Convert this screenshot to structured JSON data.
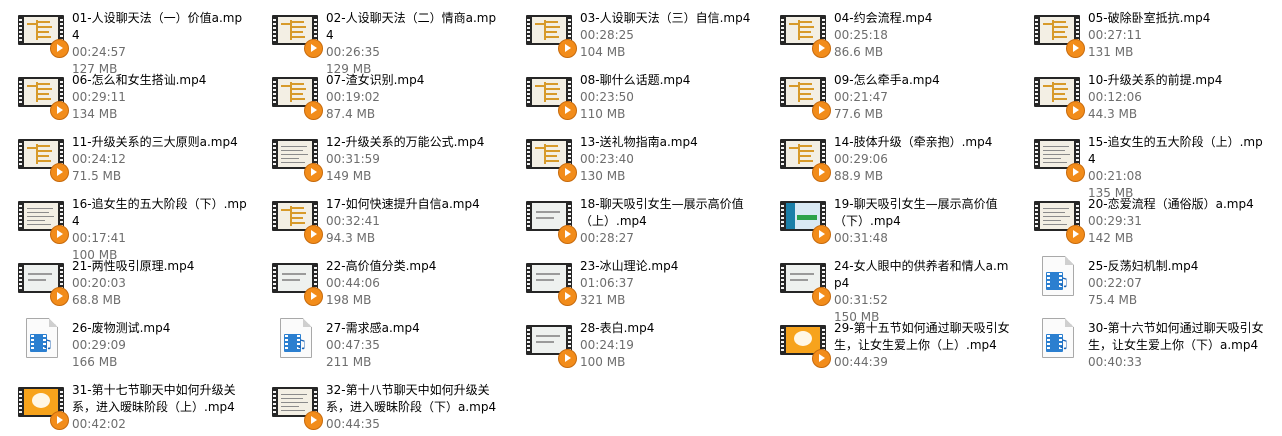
{
  "colors": {
    "duration_text": "#6d6d6d",
    "play_badge": "#f28c1a",
    "media_icon": "#2b7fd0"
  },
  "files": [
    {
      "name": "01-人设聊天法（一）价值a.mp4",
      "duration": "00:24:57",
      "size": "127 MB",
      "icon": "video-thumbnail-icon"
    },
    {
      "name": "02-人设聊天法（二）情商a.mp4",
      "duration": "00:26:35",
      "size": "129 MB",
      "icon": "video-thumbnail-icon"
    },
    {
      "name": "03-人设聊天法（三）自信.mp4",
      "duration": "00:28:25",
      "size": "104 MB",
      "icon": "video-thumbnail-icon"
    },
    {
      "name": "04-约会流程.mp4",
      "duration": "00:25:18",
      "size": "86.6 MB",
      "icon": "video-thumbnail-icon"
    },
    {
      "name": "05-破除卧室抵抗.mp4",
      "duration": "00:27:11",
      "size": "131 MB",
      "icon": "video-thumbnail-icon"
    },
    {
      "name": "06-怎么和女生搭讪.mp4",
      "duration": "00:29:11",
      "size": "134 MB",
      "icon": "video-thumbnail-icon"
    },
    {
      "name": "07-渣女识别.mp4",
      "duration": "00:19:02",
      "size": "87.4 MB",
      "icon": "video-thumbnail-icon"
    },
    {
      "name": "08-聊什么话题.mp4",
      "duration": "00:23:50",
      "size": "110 MB",
      "icon": "video-thumbnail-icon"
    },
    {
      "name": "09-怎么牵手a.mp4",
      "duration": "00:21:47",
      "size": "77.6 MB",
      "icon": "video-thumbnail-icon"
    },
    {
      "name": "10-升级关系的前提.mp4",
      "duration": "00:12:06",
      "size": "44.3 MB",
      "icon": "video-thumbnail-icon"
    },
    {
      "name": "11-升级关系的三大原则a.mp4",
      "duration": "00:24:12",
      "size": "71.5 MB",
      "icon": "video-thumbnail-icon"
    },
    {
      "name": "12-升级关系的万能公式.mp4",
      "duration": "00:31:59",
      "size": "149 MB",
      "icon": "video-thumbnail-icon"
    },
    {
      "name": "13-送礼物指南a.mp4",
      "duration": "00:23:40",
      "size": "130 MB",
      "icon": "video-thumbnail-icon"
    },
    {
      "name": "14-肢体升级（牵亲抱）.mp4",
      "duration": "00:29:06",
      "size": "88.9 MB",
      "icon": "video-thumbnail-icon"
    },
    {
      "name": "15-追女生的五大阶段（上）.mp4",
      "duration": "00:21:08",
      "size": "135 MB",
      "icon": "video-thumbnail-icon"
    },
    {
      "name": "16-追女生的五大阶段（下）.mp4",
      "duration": "00:17:41",
      "size": "100 MB",
      "icon": "video-thumbnail-icon"
    },
    {
      "name": "17-如何快速提升自信a.mp4",
      "duration": "00:32:41",
      "size": "94.3 MB",
      "icon": "video-thumbnail-icon"
    },
    {
      "name": "18-聊天吸引女生—展示高价值（上）.mp4",
      "duration": "00:28:27",
      "size": "",
      "icon": "video-thumbnail-icon"
    },
    {
      "name": "19-聊天吸引女生—展示高价值（下）.mp4",
      "duration": "00:31:48",
      "size": "",
      "icon": "video-thumbnail-icon"
    },
    {
      "name": "20-恋爱流程（通俗版）a.mp4",
      "duration": "00:29:31",
      "size": "142 MB",
      "icon": "video-thumbnail-icon"
    },
    {
      "name": "21-两性吸引原理.mp4",
      "duration": "00:20:03",
      "size": "68.8 MB",
      "icon": "video-thumbnail-icon"
    },
    {
      "name": "22-高价值分类.mp4",
      "duration": "00:44:06",
      "size": "198 MB",
      "icon": "video-thumbnail-icon"
    },
    {
      "name": "23-冰山理论.mp4",
      "duration": "01:06:37",
      "size": "321 MB",
      "icon": "video-thumbnail-icon"
    },
    {
      "name": "24-女人眼中的供养者和情人a.mp4",
      "duration": "00:31:52",
      "size": "150 MB",
      "icon": "video-thumbnail-icon"
    },
    {
      "name": "25-反荡妇机制.mp4",
      "duration": "00:22:07",
      "size": "75.4 MB",
      "icon": "media-file-icon"
    },
    {
      "name": "26-废物测试.mp4",
      "duration": "00:29:09",
      "size": "166 MB",
      "icon": "media-file-icon"
    },
    {
      "name": "27-需求感a.mp4",
      "duration": "00:47:35",
      "size": "211 MB",
      "icon": "media-file-icon"
    },
    {
      "name": "28-表白.mp4",
      "duration": "00:24:19",
      "size": "100 MB",
      "icon": "video-thumbnail-icon"
    },
    {
      "name": "29-第十五节如何通过聊天吸引女生，让女生爱上你（上）.mp4",
      "duration": "00:44:39",
      "size": "",
      "icon": "video-thumbnail-icon"
    },
    {
      "name": "30-第十六节如何通过聊天吸引女生，让女生爱上你（下）a.mp4",
      "duration": "00:40:33",
      "size": "",
      "icon": "media-file-icon"
    },
    {
      "name": "31-第十七节聊天中如何升级关系，进入暧昧阶段（上）.mp4",
      "duration": "00:42:02",
      "size": "",
      "icon": "video-thumbnail-icon"
    },
    {
      "name": "32-第十八节聊天中如何升级关系，进入暧昧阶段（下）a.mp4",
      "duration": "00:44:35",
      "size": "",
      "icon": "video-thumbnail-icon"
    }
  ]
}
